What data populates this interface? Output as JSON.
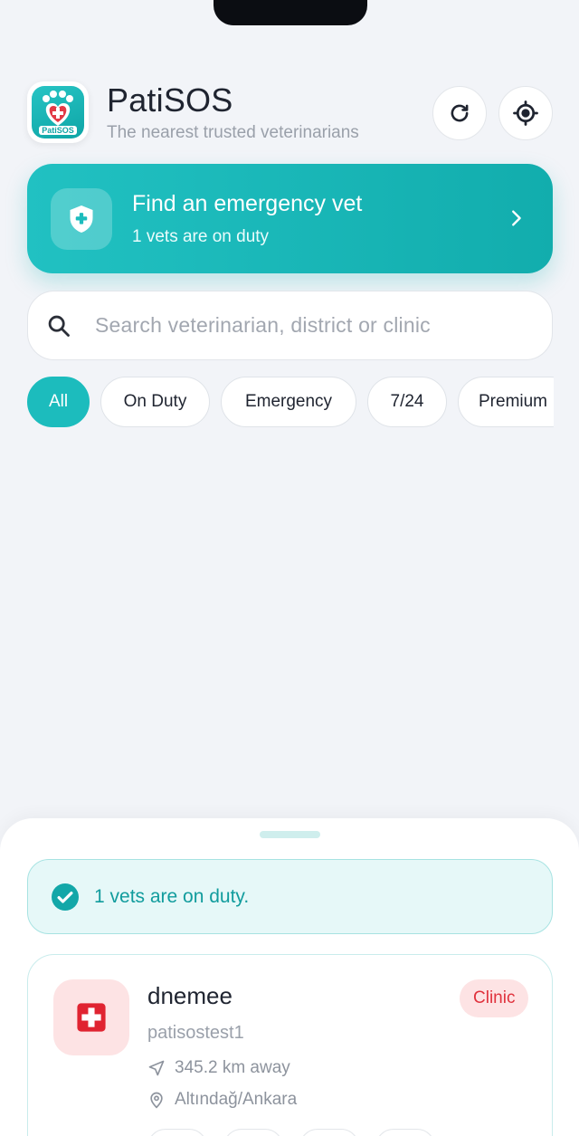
{
  "app": {
    "title": "PatiSOS",
    "subtitle": "The nearest trusted veterinarians",
    "logo_text": "PatiSOS"
  },
  "header": {
    "refresh_icon": "refresh-icon",
    "locate_icon": "crosshair-locate-icon"
  },
  "emergency": {
    "title": "Find an emergency vet",
    "subtitle": "1 vets are on duty",
    "icon": "shield-plus-icon"
  },
  "search": {
    "placeholder": "Search veterinarian, district or clinic",
    "value": ""
  },
  "filters": [
    {
      "label": "All",
      "active": true
    },
    {
      "label": "On Duty",
      "active": false
    },
    {
      "label": "Emergency",
      "active": false
    },
    {
      "label": "7/24",
      "active": false
    },
    {
      "label": "Premium",
      "active": false
    }
  ],
  "sheet": {
    "duty_message": "1 vets are on duty."
  },
  "vets": [
    {
      "name": "dnemee",
      "username": "patisostest1",
      "badge": "Clinic",
      "distance": "345.2 km away",
      "location": "Altındağ/Ankara"
    }
  ],
  "colors": {
    "accent": "#1cbcbd",
    "accent_dark": "#119c9d",
    "badge_red": "#e0323d",
    "background": "#f2f4f8"
  }
}
